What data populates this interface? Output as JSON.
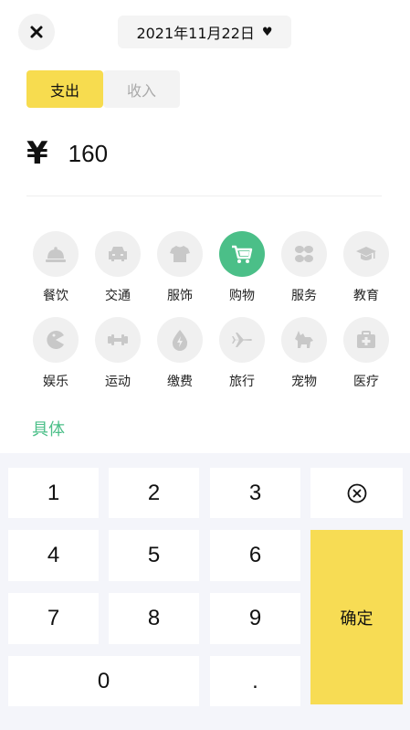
{
  "header": {
    "close_icon": "close-icon",
    "date": "2021年11月22日",
    "date_icon": "heart-icon"
  },
  "type_tabs": [
    {
      "label": "支出",
      "active": true
    },
    {
      "label": "收入",
      "active": false
    }
  ],
  "amount": {
    "currency_symbol": "¥",
    "value": "160"
  },
  "categories": [
    {
      "label": "餐饮",
      "icon": "cloche-icon",
      "selected": false
    },
    {
      "label": "交通",
      "icon": "car-icon",
      "selected": false
    },
    {
      "label": "服饰",
      "icon": "tshirt-icon",
      "selected": false
    },
    {
      "label": "购物",
      "icon": "shopping-cart-icon",
      "selected": true
    },
    {
      "label": "服务",
      "icon": "butterfly-icon",
      "selected": false
    },
    {
      "label": "教育",
      "icon": "graduation-cap-icon",
      "selected": false
    },
    {
      "label": "娱乐",
      "icon": "pacman-icon",
      "selected": false
    },
    {
      "label": "运动",
      "icon": "dumbbell-icon",
      "selected": false
    },
    {
      "label": "缴费",
      "icon": "water-drop-icon",
      "selected": false
    },
    {
      "label": "旅行",
      "icon": "airplane-icon",
      "selected": false
    },
    {
      "label": "宠物",
      "icon": "dog-icon",
      "selected": false
    },
    {
      "label": "医疗",
      "icon": "medical-kit-icon",
      "selected": false
    }
  ],
  "detail_link": "具体",
  "keypad": {
    "k1": "1",
    "k2": "2",
    "k3": "3",
    "k4": "4",
    "k5": "5",
    "k6": "6",
    "k7": "7",
    "k8": "8",
    "k9": "9",
    "k0": "0",
    "dot": ".",
    "backspace_icon": "backspace-icon",
    "confirm": "确定"
  },
  "colors": {
    "accent_yellow": "#f7dc4f",
    "accent_green": "#4bbf88",
    "keypad_bg": "#f4f5fa"
  }
}
